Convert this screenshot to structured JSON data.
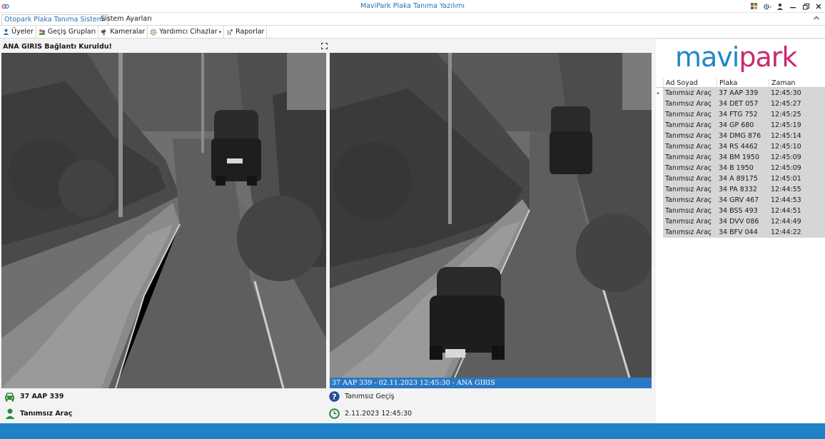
{
  "window": {
    "title": "MaviPark Plaka Tanıma Yazılımı"
  },
  "tabs": [
    {
      "label": "Otopark Plaka Tanıma Sistemi",
      "active": true
    },
    {
      "label": "Sistem Ayarları",
      "active": false
    }
  ],
  "toolbar": {
    "members": "Üyeler",
    "pass_groups": "Geçiş Grupları",
    "cameras": "Kameralar",
    "aux_devices": "Yardımcı Cihazlar",
    "reports": "Raporlar"
  },
  "camera": {
    "connection_status": "ANA GIRIS Bağlantı Kuruldu!",
    "caption": "37 AAP 339 - 02.11.2023 12:45:30 - ANA GIRIS"
  },
  "detection": {
    "plate": "37 AAP 339",
    "owner": "Tanımsız Araç",
    "pass_type": "Tanımsız Geçiş",
    "datetime": "2.11.2023 12:45:30"
  },
  "logo": {
    "part1": "mavi",
    "part2": "park"
  },
  "grid": {
    "columns": [
      "Ad Soyad",
      "Plaka",
      "Zaman"
    ],
    "rows": [
      [
        "Tanımsız Araç",
        "37 AAP 339",
        "12:45:30"
      ],
      [
        "Tanımsız Araç",
        "34 DET 057",
        "12:45:27"
      ],
      [
        "Tanımsız Araç",
        "34 FTG 752",
        "12:45:25"
      ],
      [
        "Tanımsız Araç",
        "34 GP 680",
        "12:45:19"
      ],
      [
        "Tanımsız Araç",
        "34 DMG 876",
        "12:45:14"
      ],
      [
        "Tanımsız Araç",
        "34 RS 4462",
        "12:45:10"
      ],
      [
        "Tanımsız Araç",
        "34 BM 1950",
        "12:45:09"
      ],
      [
        "Tanımsız Araç",
        "34 B 1950",
        "12:45:09"
      ],
      [
        "Tanımsız Araç",
        "34 A 89175",
        "12:45:01"
      ],
      [
        "Tanımsız Araç",
        "34 PA 8332",
        "12:44:55"
      ],
      [
        "Tanımsız Araç",
        "34 GRV 467",
        "12:44:53"
      ],
      [
        "Tanımsız Araç",
        "34 BSS 493",
        "12:44:51"
      ],
      [
        "Tanımsız Araç",
        "34 DVV 086",
        "12:44:49"
      ],
      [
        "Tanımsız Araç",
        "34 BFV 044",
        "12:44:22"
      ]
    ]
  },
  "colors": {
    "accent": "#2a79c4",
    "status_bar": "#1e82c8",
    "logo_blue": "#1e87c8",
    "logo_pink": "#c8296f",
    "icon_green": "#2e8b3c",
    "grid_row": "#d6d6d6"
  }
}
